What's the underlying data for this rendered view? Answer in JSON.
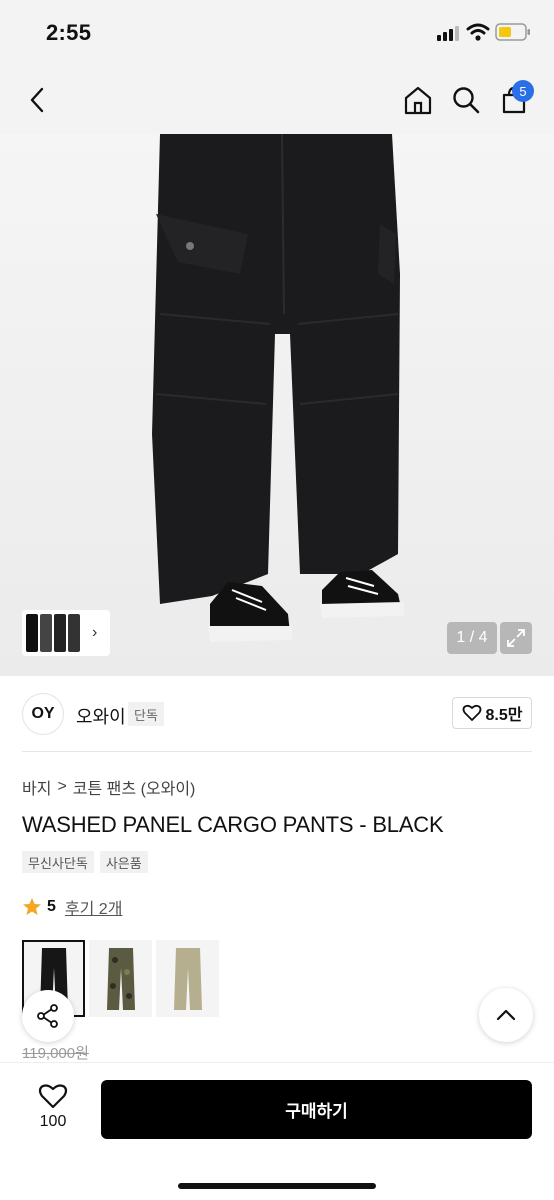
{
  "status_bar": {
    "time": "2:55"
  },
  "nav": {
    "cart_count": "5"
  },
  "gallery": {
    "counter": "1 / 4"
  },
  "brand": {
    "logo_text": "OY",
    "name": "오와이",
    "tag": "단독",
    "likes": "8.5만"
  },
  "breadcrumb": {
    "category": "바지",
    "separator": ">",
    "subcategory": "코튼 팬츠 (오와이)"
  },
  "product": {
    "title": "WASHED PANEL CARGO PANTS - BLACK",
    "tags": [
      "무신사단독",
      "사은품"
    ],
    "rating": "5",
    "review_label": "후기 2개",
    "original_price": "119,000원"
  },
  "colors": {
    "star": "#f5a623",
    "badge": "#2b6fe8",
    "buy_button": "#000000"
  },
  "bottom_bar": {
    "wish_count": "100",
    "buy_label": "구매하기"
  }
}
